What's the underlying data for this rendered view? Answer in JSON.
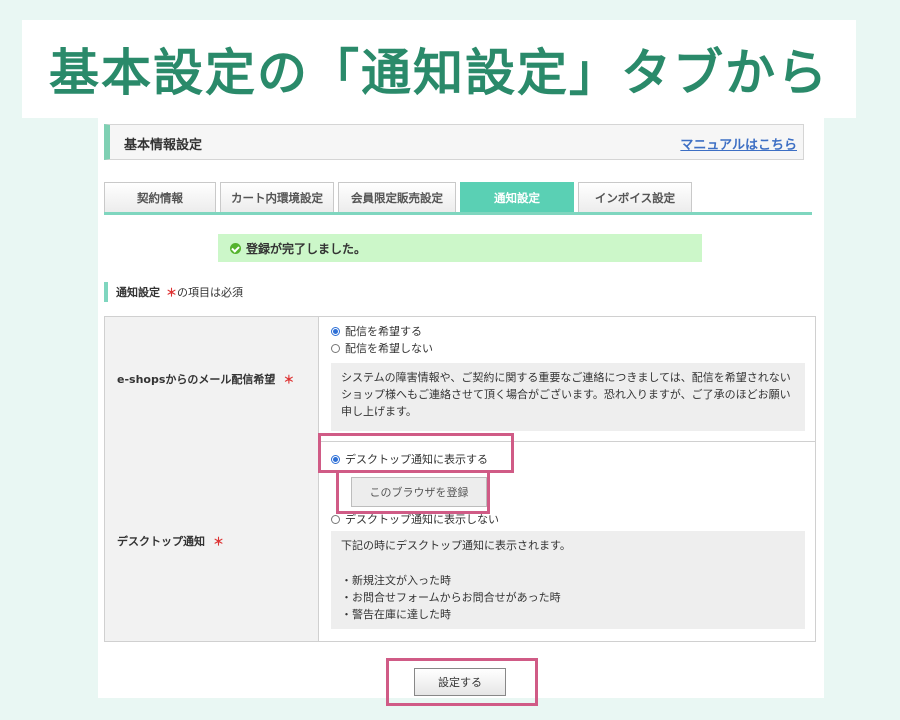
{
  "headline": "基本設定の「通知設定」タブから",
  "header": {
    "title": "基本情報設定",
    "manual_link": "マニュアルはこちら"
  },
  "tabs": [
    {
      "label": "契約情報",
      "active": false
    },
    {
      "label": "カート内環境設定",
      "active": false
    },
    {
      "label": "会員限定販売設定",
      "active": false
    },
    {
      "label": "通知設定",
      "active": true
    },
    {
      "label": "インボイス設定",
      "active": false
    }
  ],
  "success_message": "登録が完了しました。",
  "section": {
    "title": "通知設定",
    "required_mark": "＊",
    "required_note": "の項目は必須"
  },
  "form": {
    "mail": {
      "label": "e-shopsからのメール配信希望",
      "required_mark": "＊",
      "options": [
        "配信を希望する",
        "配信を希望しない"
      ],
      "selected": "配信を希望する",
      "note": "システムの障害情報や、ご契約に関する重要なご連絡につきましては、配信を希望されないショップ様へもご連絡させて頂く場合がございます。恐れ入りますが、ご了承のほどお願い申し上げます。"
    },
    "desktop": {
      "label": "デスクトップ通知",
      "required_mark": "＊",
      "options": [
        "デスクトップ通知に表示する",
        "デスクトップ通知に表示しない"
      ],
      "selected": "デスクトップ通知に表示する",
      "register_button": "このブラウザを登録",
      "note_intro": "下記の時にデスクトップ通知に表示されます。",
      "note_items": [
        "・新規注文が入った時",
        "・お問合せフォームからお問合せがあった時",
        "・警告在庫に達した時"
      ]
    }
  },
  "submit_label": "設定する",
  "colors": {
    "headline": "#2a8a6a",
    "accent": "#5ad0b4",
    "highlight": "#d05b86",
    "success_bg": "#ccf7c9",
    "link": "#3d6fc4"
  }
}
